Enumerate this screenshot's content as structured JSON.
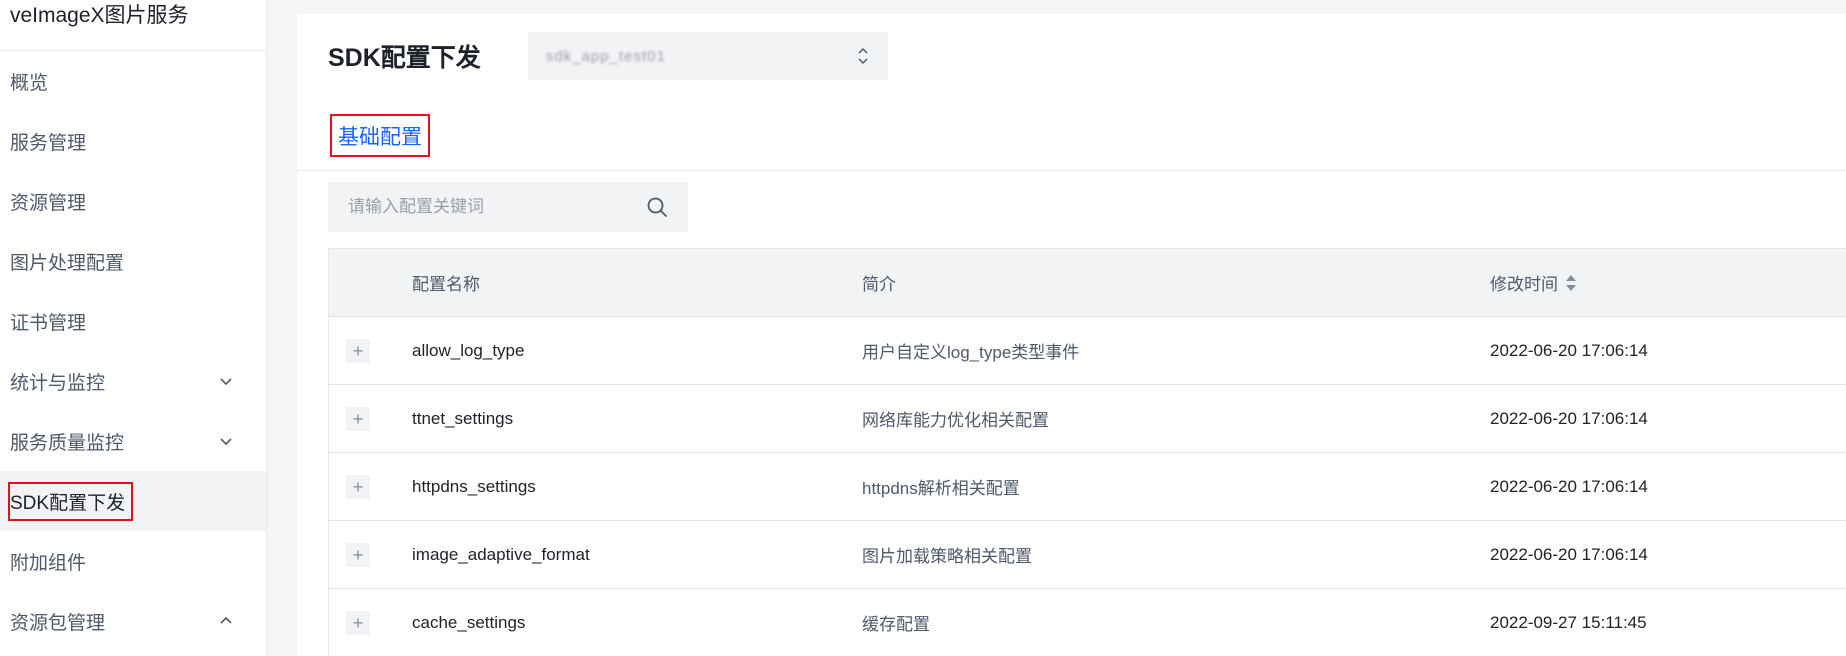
{
  "sidebar": {
    "brand": "veImageX图片服务",
    "items": [
      {
        "label": "概览"
      },
      {
        "label": "服务管理"
      },
      {
        "label": "资源管理"
      },
      {
        "label": "图片处理配置"
      },
      {
        "label": "证书管理"
      },
      {
        "label": "统计与监控",
        "chevron": "chevron-down-icon"
      },
      {
        "label": "服务质量监控",
        "chevron": "chevron-down-icon"
      },
      {
        "label": "SDK配置下发",
        "active": true
      },
      {
        "label": "附加组件"
      },
      {
        "label": "资源包管理",
        "chevron": "chevron-up-icon"
      }
    ]
  },
  "header": {
    "title": "SDK配置下发",
    "app_select_value": "sdk_app_test01"
  },
  "tabs": [
    {
      "label": "基础配置",
      "active": true
    }
  ],
  "search": {
    "placeholder": "请输入配置关键词",
    "icon": "search-icon"
  },
  "table": {
    "columns": [
      "配置名称",
      "简介",
      "修改时间"
    ],
    "rows": [
      {
        "name": "allow_log_type",
        "desc": "用户自定义log_type类型事件",
        "time": "2022-06-20 17:06:14"
      },
      {
        "name": "ttnet_settings",
        "desc": "网络库能力优化相关配置",
        "time": "2022-06-20 17:06:14"
      },
      {
        "name": "httpdns_settings",
        "desc": "httpdns解析相关配置",
        "time": "2022-06-20 17:06:14"
      },
      {
        "name": "image_adaptive_format",
        "desc": "图片加载策略相关配置",
        "time": "2022-06-20 17:06:14"
      },
      {
        "name": "cache_settings",
        "desc": "缓存配置",
        "time": "2022-09-27 15:11:45"
      }
    ],
    "expand_symbol": "+"
  },
  "colors": {
    "accent": "#1664ff",
    "highlight_box": "#e0121d"
  }
}
